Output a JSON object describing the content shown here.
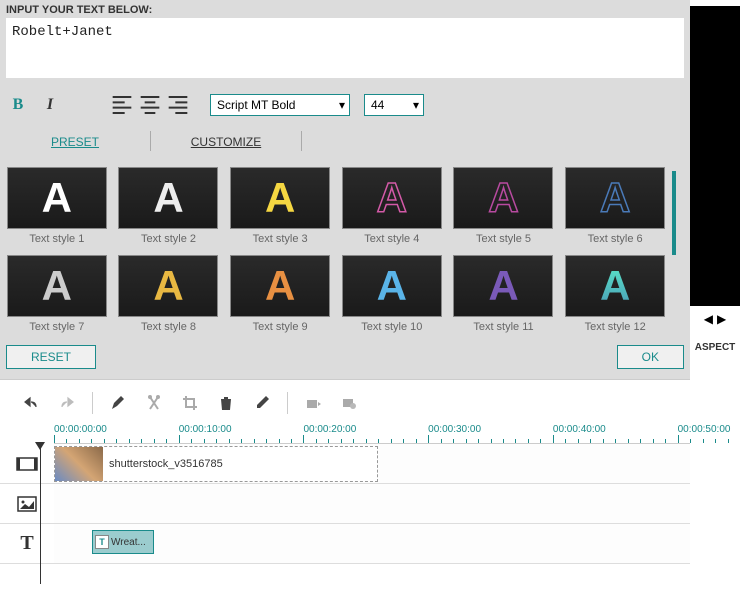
{
  "input_label": "INPUT YOUR TEXT BELOW:",
  "input_value": "Robelt+Janet",
  "toolbar": {
    "bold": "B",
    "italic": "I",
    "font": "Script MT Bold",
    "size": "44"
  },
  "tabs": {
    "preset": "PRESET",
    "customize": "CUSTOMIZE"
  },
  "presets": [
    {
      "label": "Text style 1",
      "cls": "a-white"
    },
    {
      "label": "Text style 2",
      "cls": "a-white-thin"
    },
    {
      "label": "Text style 3",
      "cls": "a-yellow"
    },
    {
      "label": "Text style 4",
      "cls": "a-pink-outline"
    },
    {
      "label": "Text style 5",
      "cls": "a-magenta-outline"
    },
    {
      "label": "Text style 6",
      "cls": "a-blue-outline"
    },
    {
      "label": "Text style 7",
      "cls": "a-gray"
    },
    {
      "label": "Text style 8",
      "cls": "a-yellow2"
    },
    {
      "label": "Text style 9",
      "cls": "a-orange"
    },
    {
      "label": "Text style 10",
      "cls": "a-lightblue"
    },
    {
      "label": "Text style 11",
      "cls": "a-purple"
    },
    {
      "label": "Text style 12",
      "cls": "a-cyangrad"
    }
  ],
  "buttons": {
    "reset": "RESET",
    "ok": "OK"
  },
  "timeline": {
    "marks": [
      "00:00:00:00",
      "00:00:10:00",
      "00:00:20:00",
      "00:00:30:00",
      "00:00:40:00",
      "00:00:50:00"
    ],
    "video_clip": "shutterstock_v3516785",
    "text_clip": "Wreat..."
  },
  "preview": {
    "aspect": "ASPECT"
  }
}
